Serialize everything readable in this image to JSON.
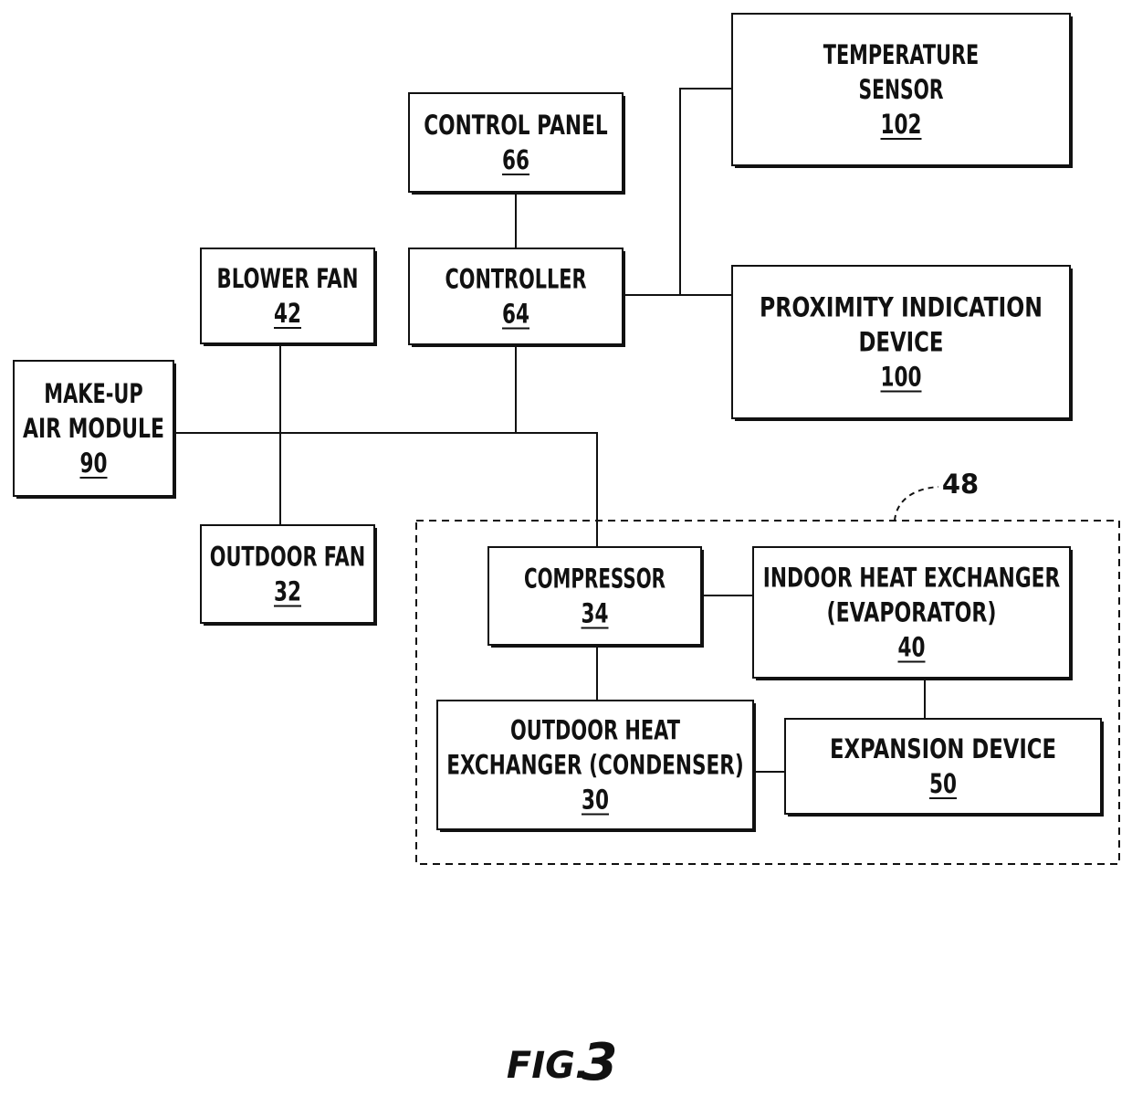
{
  "figure": {
    "caption_prefix": "FIG.",
    "caption_number": "3"
  },
  "group": {
    "ref": "48"
  },
  "blocks": [
    {
      "id": "control-panel",
      "lines": [
        "CONTROL PANEL"
      ],
      "ref": "66"
    },
    {
      "id": "controller",
      "lines": [
        "CONTROLLER"
      ],
      "ref": "64"
    },
    {
      "id": "blower-fan",
      "lines": [
        "BLOWER FAN"
      ],
      "ref": "42"
    },
    {
      "id": "temperature-sensor",
      "lines": [
        "TEMPERATURE",
        "SENSOR"
      ],
      "ref": "102"
    },
    {
      "id": "proximity-indication-device",
      "lines": [
        "PROXIMITY INDICATION",
        "DEVICE"
      ],
      "ref": "100"
    },
    {
      "id": "make-up-air-module",
      "lines": [
        "MAKE-UP",
        "AIR MODULE"
      ],
      "ref": "90"
    },
    {
      "id": "outdoor-fan",
      "lines": [
        "OUTDOOR FAN"
      ],
      "ref": "32"
    },
    {
      "id": "compressor",
      "lines": [
        "COMPRESSOR"
      ],
      "ref": "34"
    },
    {
      "id": "indoor-heat-exchanger",
      "lines": [
        "INDOOR HEAT EXCHANGER",
        "(EVAPORATOR)"
      ],
      "ref": "40"
    },
    {
      "id": "outdoor-heat-exchanger",
      "lines": [
        "OUTDOOR HEAT",
        "EXCHANGER (CONDENSER)"
      ],
      "ref": "30"
    },
    {
      "id": "expansion-device",
      "lines": [
        "EXPANSION DEVICE"
      ],
      "ref": "50"
    }
  ],
  "connections": [
    [
      "control-panel",
      "controller"
    ],
    [
      "controller",
      "temperature-sensor"
    ],
    [
      "controller",
      "proximity-indication-device"
    ],
    [
      "controller",
      "make-up-air-module"
    ],
    [
      "controller",
      "compressor"
    ],
    [
      "blower-fan",
      "outdoor-fan"
    ],
    [
      "compressor",
      "indoor-heat-exchanger"
    ],
    [
      "compressor",
      "outdoor-heat-exchanger"
    ],
    [
      "indoor-heat-exchanger",
      "expansion-device"
    ],
    [
      "outdoor-heat-exchanger",
      "expansion-device"
    ]
  ]
}
